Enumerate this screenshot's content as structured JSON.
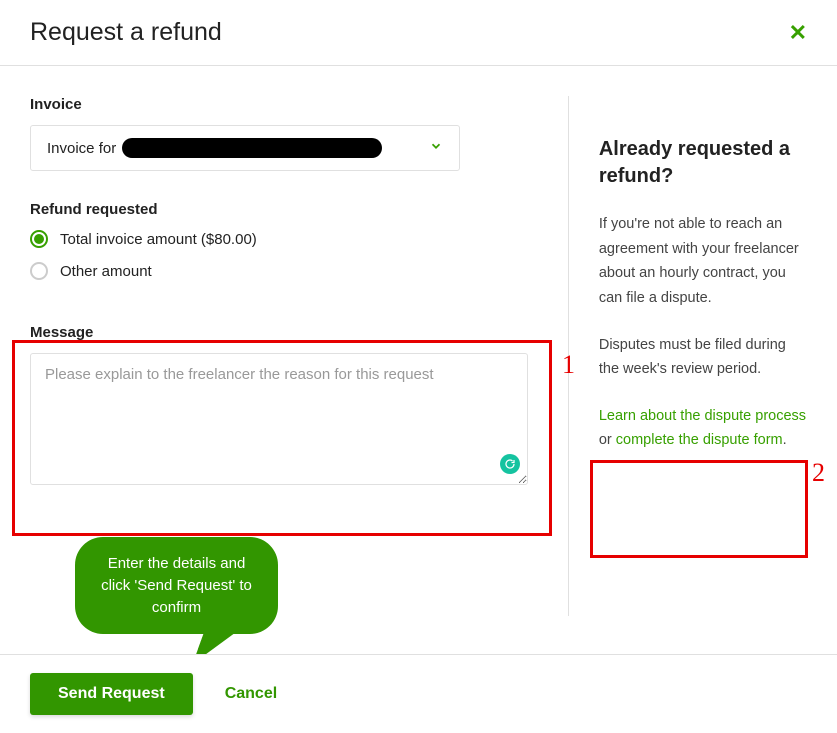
{
  "header": {
    "title": "Request a refund"
  },
  "invoice": {
    "label": "Invoice",
    "prefix": "Invoice for"
  },
  "refund": {
    "label": "Refund requested",
    "options": [
      {
        "label": "Total invoice amount ($80.00)",
        "selected": true
      },
      {
        "label": "Other amount",
        "selected": false
      }
    ]
  },
  "message": {
    "label": "Message",
    "placeholder": "Please explain to the freelancer the reason for this request",
    "value": ""
  },
  "callouts": {
    "num1": "1",
    "num2": "2",
    "bubble": "Enter the details and click 'Send Request' to confirm"
  },
  "sidebar": {
    "heading": "Already requested a refund?",
    "para1": "If you're not able to reach an agreement with your freelancer about an hourly contract, you can file a dispute.",
    "para2": "Disputes must be filed during the week's review period.",
    "link1": "Learn about the dispute process",
    "link_sep": " or ",
    "link2": "complete the dispute form",
    "link_end": "."
  },
  "footer": {
    "send": "Send Request",
    "cancel": "Cancel"
  }
}
